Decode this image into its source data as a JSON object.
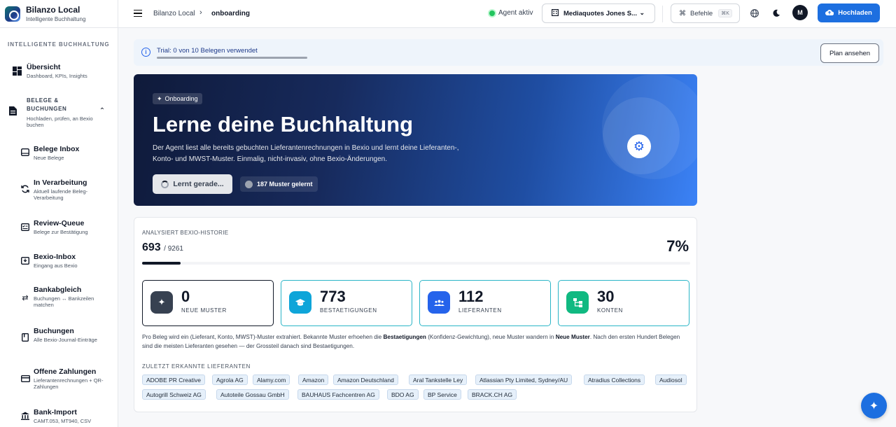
{
  "brand": {
    "title": "Bilanzo Local",
    "subtitle": "Intelligente Buchhaltung"
  },
  "sidebar": {
    "section": "INTELLIGENTE BUCHHALTUNG",
    "overview": {
      "label": "Übersicht",
      "sub": "Dashboard, KPIs, Insights",
      "icon": "dashboard-icon"
    },
    "group": {
      "line1": "BELEGE &",
      "line2": "BUCHUNGEN",
      "sub": "Hochladen, prüfen, an Bexio buchen",
      "icon": "document-icon"
    },
    "items": [
      {
        "label": "Belege Inbox",
        "sub": "Neue Belege",
        "icon": "inbox-icon"
      },
      {
        "label": "In Verarbeitung",
        "sub": "Aktuell laufende Beleg-Verarbeitung",
        "icon": "sync-icon"
      },
      {
        "label": "Review-Queue",
        "sub": "Belege zur Bestätigung",
        "icon": "checklist-icon"
      },
      {
        "label": "Bexio-Inbox",
        "sub": "Eingang aus Bexio",
        "icon": "download-box-icon"
      },
      {
        "label": "Bankabgleich",
        "sub": "Buchungen ↔ Bankzeilen matchen",
        "icon": "compare-arrows-icon"
      },
      {
        "label": "Buchungen",
        "sub": "Alle Bexio-Journal-Einträge",
        "icon": "book-icon"
      },
      {
        "label": "Offene Zahlungen",
        "sub": "Lieferantenrechnungen + QR-Zahlungen",
        "icon": "credit-card-icon"
      },
      {
        "label": "Bank-Import",
        "sub": "CAMT.053, MT940, CSV",
        "icon": "bank-icon"
      }
    ]
  },
  "topbar": {
    "breadcrumb": [
      "Bilanzo Local",
      "onboarding"
    ],
    "agent_status": "Agent aktiv",
    "company": "Mediaquotes Jones S...",
    "commands": "Befehle",
    "commands_kbd": "⌘K",
    "avatar": "M",
    "upload": "Hochladen"
  },
  "trial": {
    "text": "Trial: 0 von 10 Belegen verwendet",
    "used": 0,
    "limit": 10,
    "button": "Plan ansehen"
  },
  "hero": {
    "badge": "Onboarding",
    "title": "Lerne deine Buchhaltung",
    "description": "Der Agent liest alle bereits gebuchten Lieferantenrechnungen in Bexio und lernt deine Lieferanten-, Konto- und MWST-Muster. Einmalig, nicht-invasiv, ohne Bexio-Änderungen.",
    "button": "Lernt gerade...",
    "pill": "187 Muster gelernt"
  },
  "analysis": {
    "label": "ANALYSIERT BEXIO-HISTORIE",
    "done": "693",
    "total": "/ 9261",
    "percent": "7%",
    "progress": 0.07,
    "stats": [
      {
        "value": "0",
        "label": "NEUE MUSTER",
        "color": "#374151",
        "icon": "sparkle-icon"
      },
      {
        "value": "773",
        "label": "BESTAETIGUNGEN",
        "color": "#0ea5d9",
        "icon": "graduation-cap-icon"
      },
      {
        "value": "112",
        "label": "LIEFERANTEN",
        "color": "#2563eb",
        "icon": "people-icon"
      },
      {
        "value": "30",
        "label": "KONTEN",
        "color": "#10b981",
        "icon": "account-tree-icon"
      }
    ],
    "explanation_parts": [
      "Pro Beleg wird ein (Lieferant, Konto, MWST)-Muster extrahiert. Bekannte Muster erhoehen die ",
      "Bestaetigungen",
      " (Konfidenz-Gewichtung), neue Muster wandern in ",
      "Neue Muster",
      ". Nach den ersten Hundert Belegen sind die meisten Lieferanten gesehen — der Grossteil danach sind Bestaetigungen."
    ],
    "recent_label": "ZULETZT ERKANNTE LIEFERANTEN",
    "suppliers": [
      "ADOBE PR Creative",
      "Agrola AG",
      "Alamy.com",
      "Amazon",
      "Amazon Deutschland",
      "Aral Tankstelle Ley",
      "Atlassian Pty Limited, Sydney/AU",
      "Atradius Collections",
      "Audiosol",
      "Autogrill Schweiz AG",
      "Autoteile Gossau GmbH",
      "BAUHAUS Fachcentren AG",
      "BDO AG",
      "BP Service",
      "BRACK.CH AG"
    ]
  }
}
